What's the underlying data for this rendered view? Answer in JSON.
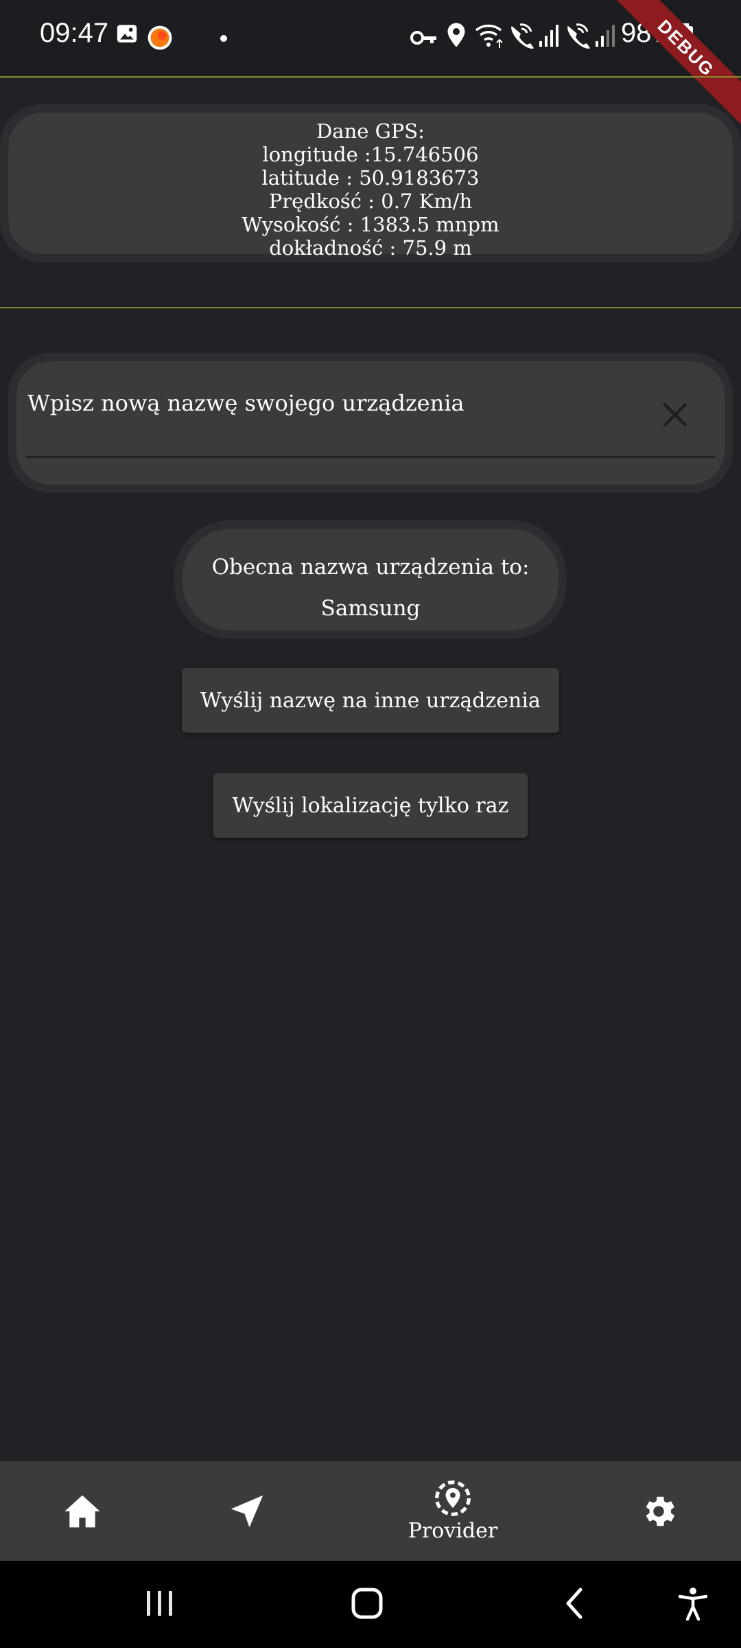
{
  "status_bar": {
    "time": "09:47",
    "battery": "98%",
    "icons": [
      "gallery-icon",
      "orange-app-icon",
      "dot-icon",
      "vpn-key-icon",
      "location-icon",
      "wifi-icon",
      "wifi-call-1-icon",
      "signal-1-icon",
      "wifi-call-2-icon",
      "signal-2-icon",
      "battery-icon"
    ],
    "debug_label": "DEBUG"
  },
  "gps": {
    "title": "Dane GPS:",
    "longitude": "longitude :15.746506",
    "latitude": "latitude : 50.9183673",
    "speed": "Prędkość : 0.7 Km/h",
    "altitude": "Wysokość : 1383.5 mnpm",
    "accuracy": "dokładność : 75.9 m"
  },
  "device_name": {
    "placeholder": "Wpisz nową nazwę swojego urządzenia",
    "current_label": "Obecna nazwa urządzenia to:",
    "current_value": "Samsung"
  },
  "buttons": {
    "send_name": "Wyślij nazwę na inne urządzenia",
    "send_location": "Wyślij lokalizację tylko raz"
  },
  "bottom_nav": {
    "items": [
      {
        "icon": "home-icon",
        "label": ""
      },
      {
        "icon": "navigation-arrow-icon",
        "label": ""
      },
      {
        "icon": "location-provider-icon",
        "label": "Provider",
        "active": true
      },
      {
        "icon": "settings-gear-icon",
        "label": ""
      }
    ]
  },
  "colors": {
    "background": "#212226",
    "card": "#3b3b3d",
    "card_border": "#2c2d30",
    "divider": "#8a8a2a",
    "debug_banner": "#8e1b1f"
  }
}
